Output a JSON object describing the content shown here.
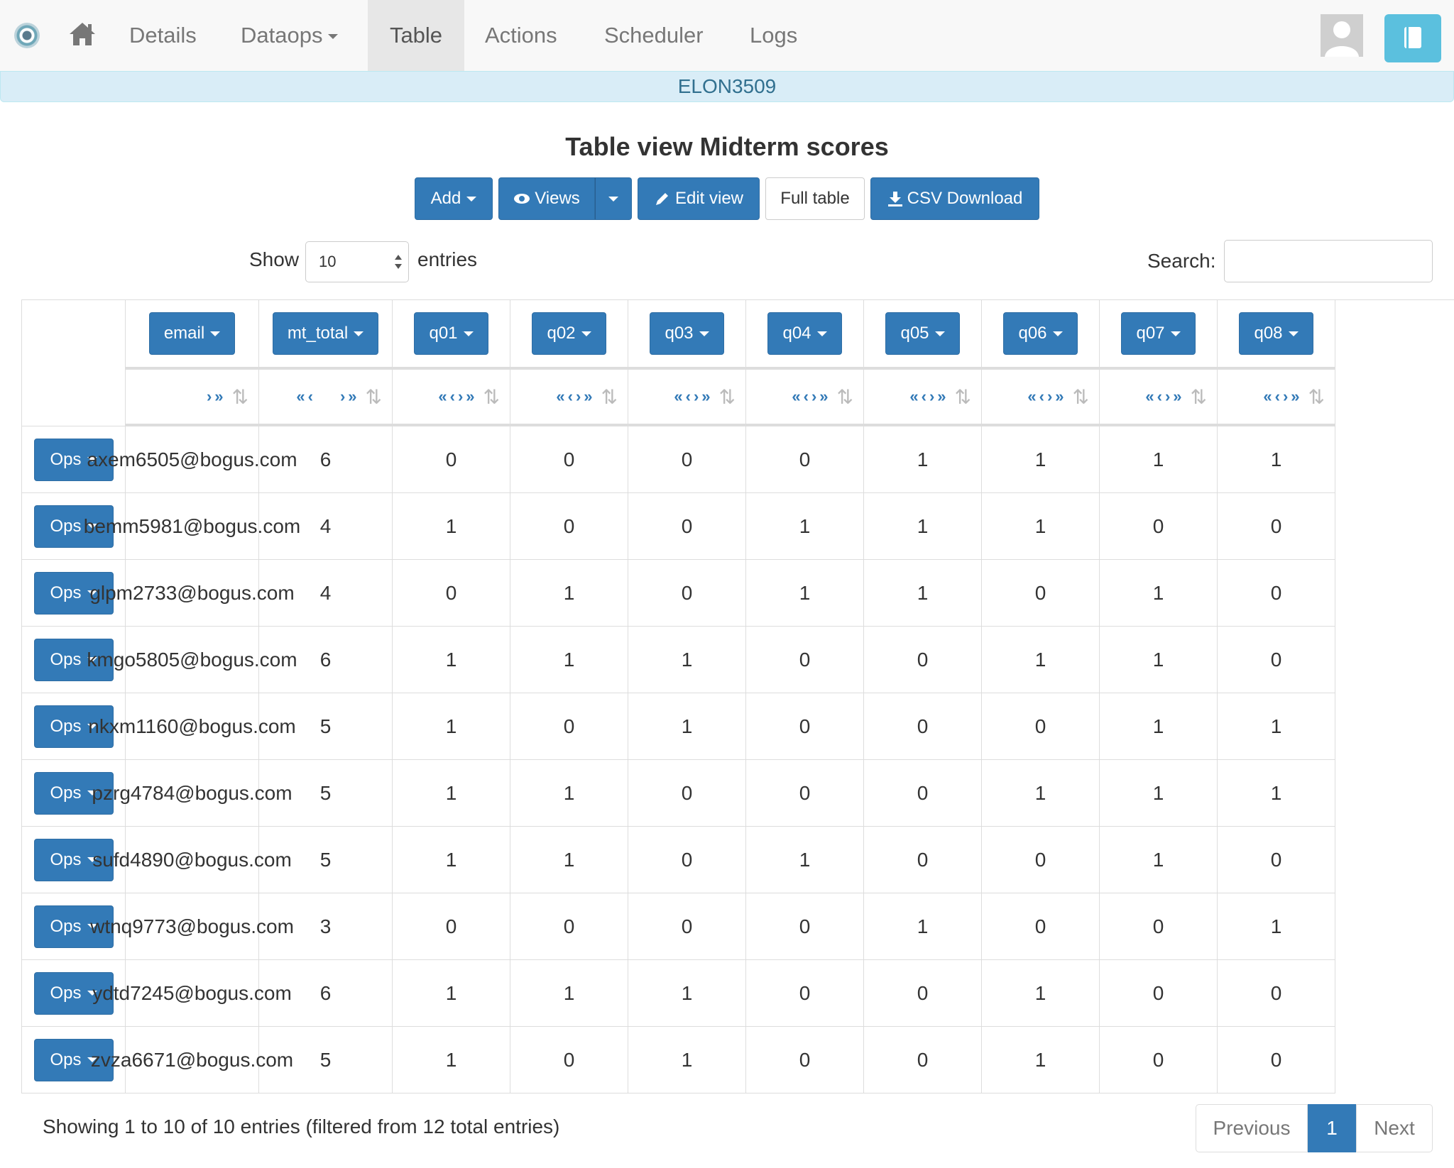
{
  "nav": {
    "items": [
      "Details",
      "Dataops",
      "Table",
      "Actions",
      "Scheduler",
      "Logs"
    ],
    "active": "Table"
  },
  "banner": "ELON3509",
  "page_title": "Table view Midterm scores",
  "toolbar": {
    "add": "Add",
    "views": "Views",
    "edit_view": "Edit view",
    "full_table": "Full table",
    "csv_download": "CSV Download"
  },
  "show": {
    "label": "Show",
    "value": "10",
    "suffix": "entries"
  },
  "search": {
    "label": "Search:",
    "value": ""
  },
  "table": {
    "columns": [
      "email",
      "mt_total",
      "q01",
      "q02",
      "q03",
      "q04",
      "q05",
      "q06",
      "q07",
      "q08"
    ],
    "ops_label": "Ops",
    "rows": [
      [
        "axem6505@bogus.com",
        "6",
        "0",
        "0",
        "0",
        "0",
        "1",
        "1",
        "1",
        "1"
      ],
      [
        "bemm5981@bogus.com",
        "4",
        "1",
        "0",
        "0",
        "1",
        "1",
        "1",
        "0",
        "0"
      ],
      [
        "glpm2733@bogus.com",
        "4",
        "0",
        "1",
        "0",
        "1",
        "1",
        "0",
        "1",
        "0"
      ],
      [
        "kmgo5805@bogus.com",
        "6",
        "1",
        "1",
        "1",
        "0",
        "0",
        "1",
        "1",
        "0"
      ],
      [
        "nkxm1160@bogus.com",
        "5",
        "1",
        "0",
        "1",
        "0",
        "0",
        "0",
        "1",
        "1"
      ],
      [
        "pzrg4784@bogus.com",
        "5",
        "1",
        "1",
        "0",
        "0",
        "0",
        "1",
        "1",
        "1"
      ],
      [
        "sufd4890@bogus.com",
        "5",
        "1",
        "1",
        "0",
        "1",
        "0",
        "0",
        "1",
        "0"
      ],
      [
        "wtnq9773@bogus.com",
        "3",
        "0",
        "0",
        "0",
        "0",
        "1",
        "0",
        "0",
        "1"
      ],
      [
        "ydtd7245@bogus.com",
        "6",
        "1",
        "1",
        "1",
        "0",
        "0",
        "1",
        "0",
        "0"
      ],
      [
        "zvza6671@bogus.com",
        "5",
        "1",
        "0",
        "1",
        "0",
        "0",
        "1",
        "0",
        "0"
      ]
    ]
  },
  "footer": {
    "info": "Showing 1 to 10 of 10 entries (filtered from 12 total entries)",
    "previous": "Previous",
    "page": "1",
    "next": "Next"
  },
  "colors": {
    "primary": "#337ab7",
    "banner_bg": "#d9edf7",
    "banner_text": "#31708f",
    "info_button": "#5bc0de"
  }
}
